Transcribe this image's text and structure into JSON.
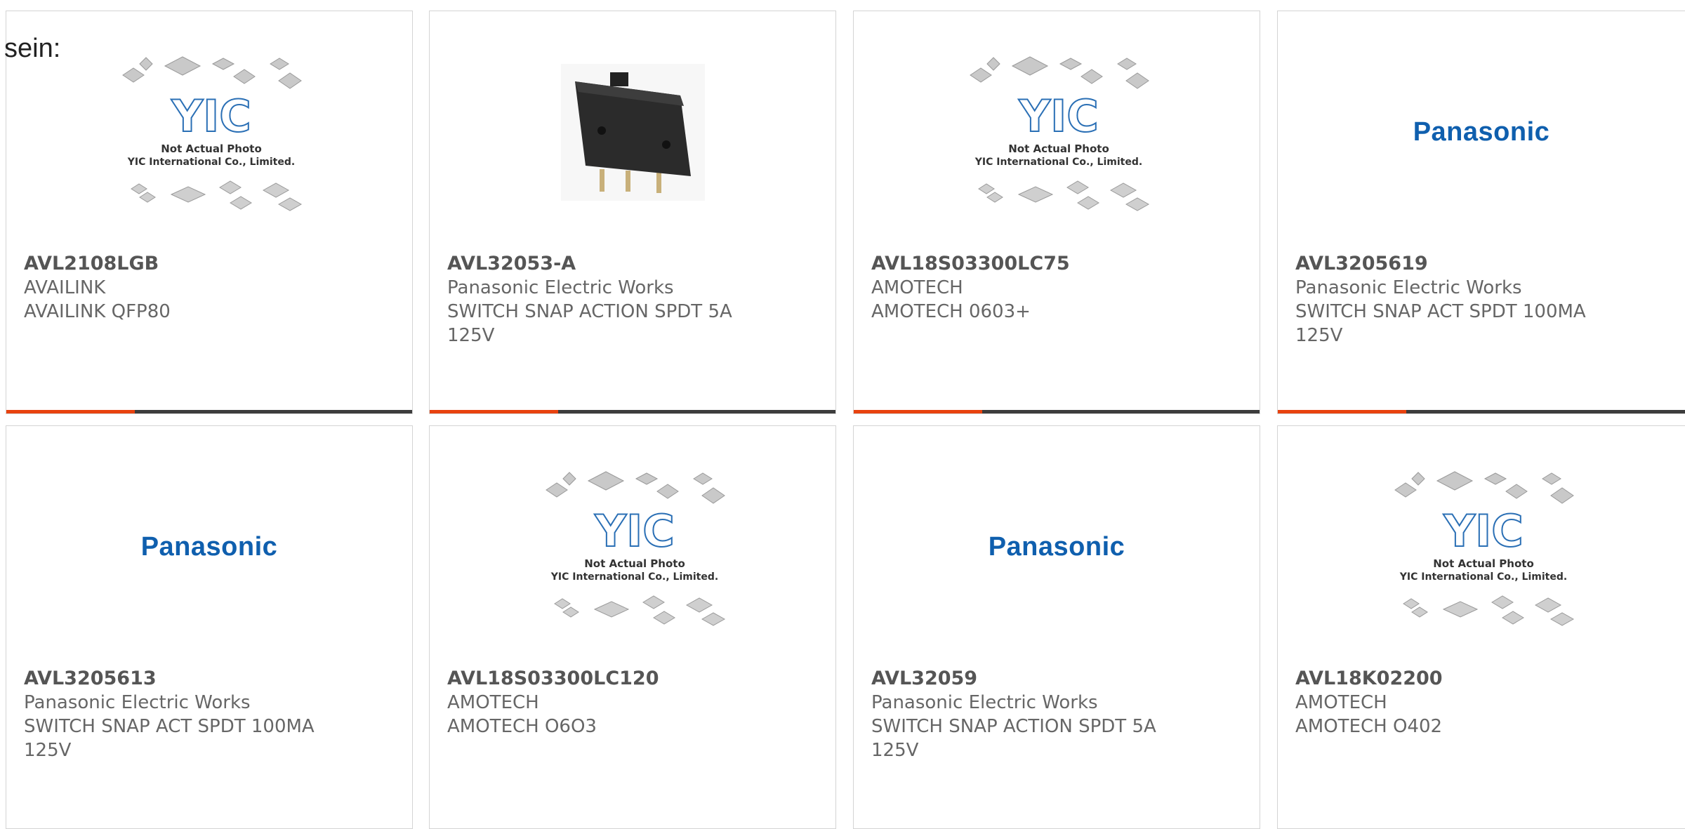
{
  "lead_text": "sein:",
  "placeholder": {
    "logo_text": "YIC",
    "line1": "Not Actual Photo",
    "line2": "YIC International Co., Limited."
  },
  "colors": {
    "accent": "#e8420f",
    "bar": "#3c3c3c",
    "panasonic_blue": "#0f5fae"
  },
  "products": [
    {
      "part": "AVL2108LGB",
      "maker": "AVAILINK",
      "desc": "AVAILINK QFP80",
      "image": "yic-placeholder"
    },
    {
      "part": "AVL32053-A",
      "maker": "Panasonic Electric Works",
      "desc": "SWITCH SNAP ACTION SPDT 5A 125V",
      "image": "switch-photo"
    },
    {
      "part": "AVL18S03300LC75",
      "maker": "AMOTECH",
      "desc": "AMOTECH 0603+",
      "image": "yic-placeholder"
    },
    {
      "part": "AVL3205619",
      "maker": "Panasonic Electric Works",
      "desc": "SWITCH SNAP ACT SPDT 100MA 125V",
      "image": "panasonic-logo",
      "logo_text": "Panasonic"
    },
    {
      "part": "AVL3205613",
      "maker": "Panasonic Electric Works",
      "desc": "SWITCH SNAP ACT SPDT 100MA 125V",
      "image": "panasonic-logo",
      "logo_text": "Panasonic"
    },
    {
      "part": "AVL18S03300LC120",
      "maker": "AMOTECH",
      "desc": "AMOTECH O6O3",
      "image": "yic-placeholder"
    },
    {
      "part": "AVL32059",
      "maker": "Panasonic Electric Works",
      "desc": "SWITCH SNAP ACTION SPDT 5A 125V",
      "image": "panasonic-logo",
      "logo_text": "Panasonic"
    },
    {
      "part": "AVL18K02200",
      "maker": "AMOTECH",
      "desc": "AMOTECH O402",
      "image": "yic-placeholder"
    }
  ]
}
